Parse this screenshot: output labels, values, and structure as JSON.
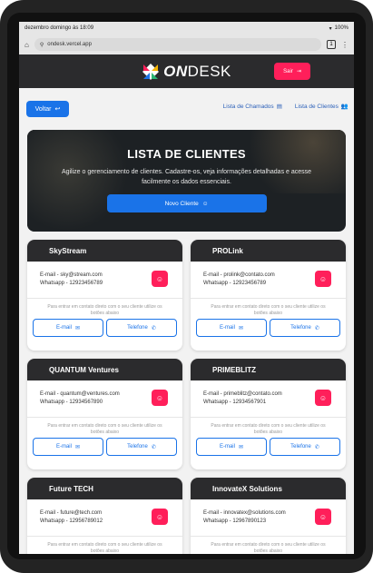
{
  "statusbar": {
    "time": "dezembro domingo às 18:09",
    "battery": "100%"
  },
  "browser": {
    "url": "ondesk.vercel.app",
    "tab_count": "1"
  },
  "header": {
    "logo_on": "ON",
    "logo_desk": "DESK",
    "sair_label": "Sair"
  },
  "nav": {
    "voltar_label": "Voltar",
    "chamados_label": "Lista de Chamados",
    "clientes_label": "Lista de Clientes"
  },
  "hero": {
    "title": "LISTA DE CLIENTES",
    "subtitle": "Agilize o gerenciamento de clientes. Cadastre-os, veja informações detalhadas e acesse facilmente os dados essenciais.",
    "new_client_label": "Novo Cliente"
  },
  "card_labels": {
    "note": "Para entrar em contato direto com o seu cliente utilize os botões abaixo",
    "email_button": "E-mail",
    "phone_button": "Telefone"
  },
  "clients": [
    {
      "name": "SkyStream",
      "email": "E-mail - sky@stream.com",
      "whatsapp": "Whatsapp - 12923456789"
    },
    {
      "name": "PROLink",
      "email": "E-mail - prolink@contato.com",
      "whatsapp": "Whatsapp - 12923456789"
    },
    {
      "name": "QUANTUM Ventures",
      "email": "E-mail - quantum@ventures.com",
      "whatsapp": "Whatsapp - 12934567890"
    },
    {
      "name": "PRIMEBLITZ",
      "email": "E-mail - primeblitz@contato.com",
      "whatsapp": "Whatsapp - 12934567901"
    },
    {
      "name": "Future TECH",
      "email": "E-mail - future@tech.com",
      "whatsapp": "Whatsapp - 12956789012"
    },
    {
      "name": "InnovateX Solutions",
      "email": "E-mail - innovatex@solutions.com",
      "whatsapp": "Whatsapp - 12967890123"
    }
  ],
  "colors": {
    "accent": "#1a73e8",
    "brand_pink": "#ff1f5a",
    "dark": "#2b2b2d"
  }
}
